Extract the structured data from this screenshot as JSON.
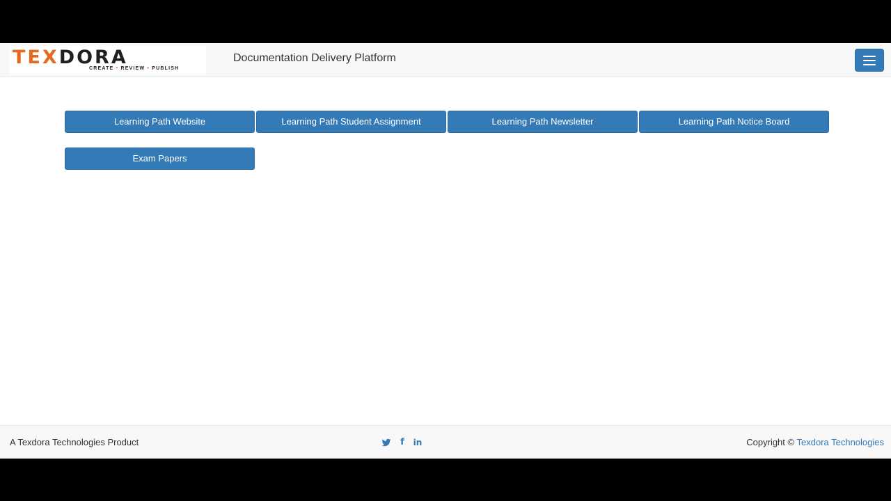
{
  "navbar": {
    "logo": {
      "word_part1": "TEX",
      "word_part2": "DORA",
      "tagline_1": "CREATE",
      "tagline_2": "REVIEW",
      "tagline_3": "PUBLISH"
    },
    "title": "Documentation Delivery Platform",
    "menu_icon": "hamburger-icon"
  },
  "main": {
    "buttons": [
      {
        "label": "Learning Path Website"
      },
      {
        "label": "Learning Path Student Assignment"
      },
      {
        "label": "Learning Path Newsletter"
      },
      {
        "label": "Learning Path Notice Board"
      },
      {
        "label": "Exam Papers"
      }
    ]
  },
  "footer": {
    "left_text": "A Texdora Technologies Product",
    "social": [
      {
        "icon": "twitter-icon"
      },
      {
        "icon": "facebook-icon",
        "glyph": "f"
      },
      {
        "icon": "linkedin-icon",
        "glyph": "in"
      }
    ],
    "copyright_prefix": "Copyright ©",
    "copyright_link": "Texdora Technologies"
  },
  "colors": {
    "primary": "#337ab7",
    "primary_border": "#2e6da4",
    "logo_orange": "#e36a1e",
    "navbar_bg": "#f8f8f8"
  }
}
